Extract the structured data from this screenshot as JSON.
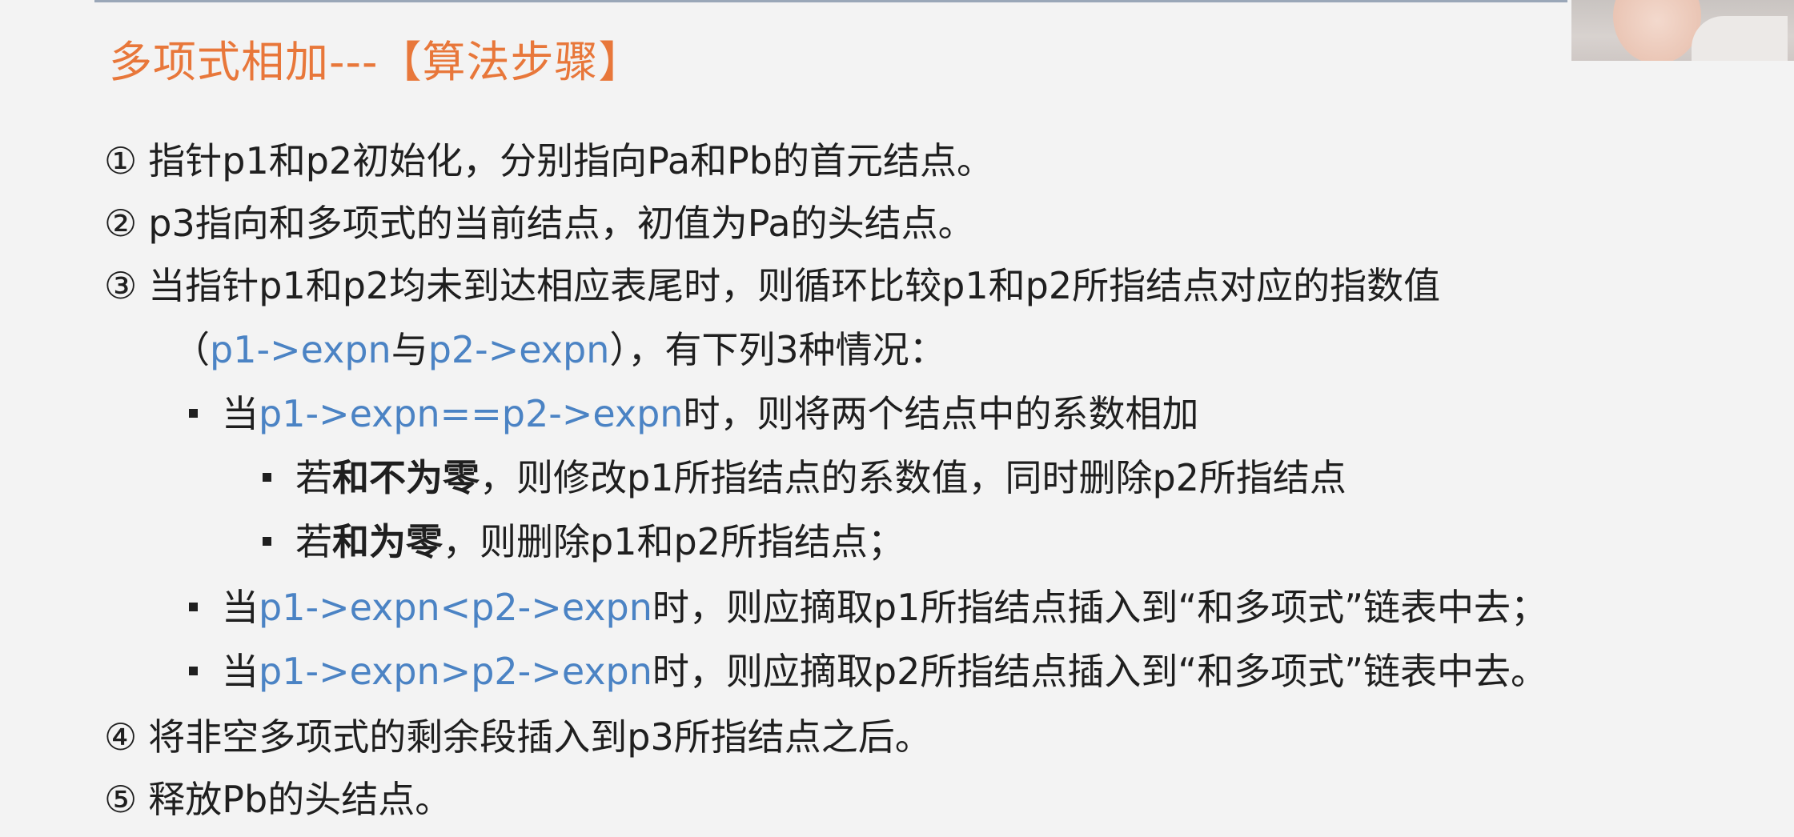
{
  "title": "多项式相加---【算法步骤】",
  "steps": {
    "s1": {
      "num": "①",
      "text": "指针p1和p2初始化，分别指向Pa和Pb的首元结点。"
    },
    "s2": {
      "num": "②",
      "text": "p3指向和多项式的当前结点，初值为Pa的头结点。"
    },
    "s3": {
      "num": "③",
      "text": "当指针p1和p2均未到达相应表尾时，则循环比较p1和p2所指结点对应的指数值",
      "cont": {
        "open": "（",
        "code1": "p1->expn",
        "mid": "与",
        "code2": "p2->expn",
        "rest": "），有下列3种情况："
      }
    },
    "cases": {
      "eq": {
        "pre": "当",
        "code": "p1->expn==p2->expn",
        "post": "时，则将两个结点中的系数相加"
      },
      "nonzero": {
        "pre": "若",
        "bold": "和不为零",
        "post": "，则修改p1所指结点的系数值，同时删除p2所指结点"
      },
      "zero": {
        "pre": "若",
        "bold": "和为零",
        "post": "，则删除p1和p2所指结点；"
      },
      "lt": {
        "pre": "当",
        "code": "p1->expn<p2->expn",
        "post": "时，则应摘取p1所指结点插入到“和多项式”链表中去；"
      },
      "gt": {
        "pre": "当",
        "code": "p1->expn>p2->expn",
        "post": "时，则应摘取p2所指结点插入到“和多项式”链表中去。"
      }
    },
    "s4": {
      "num": "④",
      "text": "将非空多项式的剩余段插入到p3所指结点之后。"
    },
    "s5": {
      "num": "⑤",
      "text": "释放Pb的头结点。"
    }
  },
  "colors": {
    "title": "#e8773a",
    "code": "#4b83c4",
    "text": "#1f1f1f",
    "background": "#f3f3f3"
  }
}
